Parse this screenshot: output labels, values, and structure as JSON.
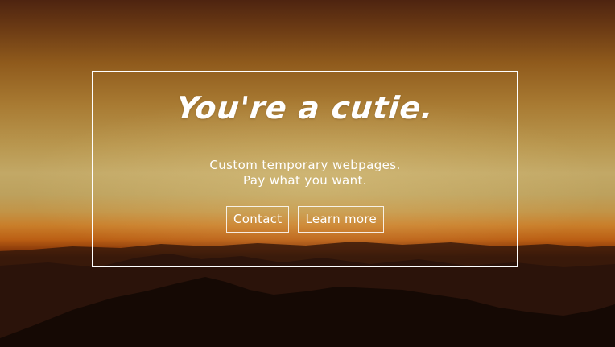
{
  "hero": {
    "title": "You're a cutie.",
    "tagline_line1": "Custom temporary webpages.",
    "tagline_line2": "Pay what you want."
  },
  "buttons": {
    "contact_label": "Contact",
    "learn_more_label": "Learn more"
  },
  "colors": {
    "frame": "#ffffff",
    "text": "#ffffff",
    "sky_top": "#4e2410",
    "sky_mid": "#c2a866",
    "horizon": "#c97e2a",
    "ground": "#1b0c06"
  }
}
